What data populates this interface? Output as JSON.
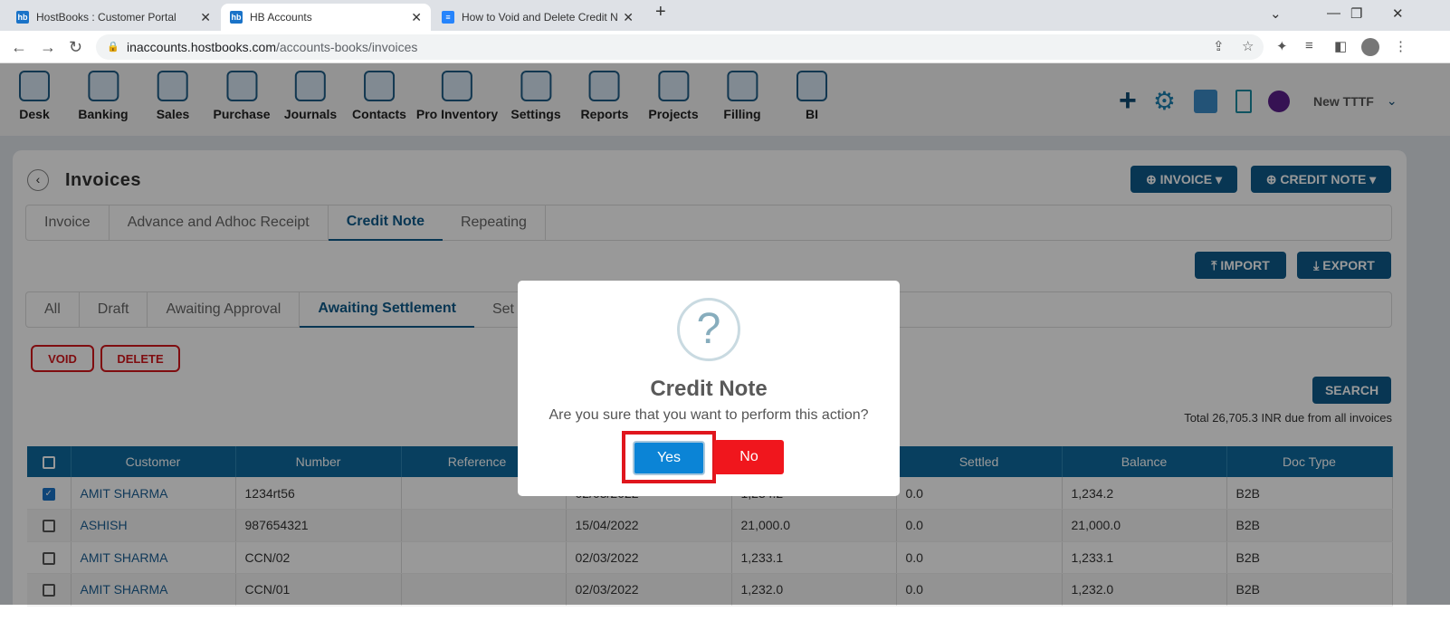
{
  "browser": {
    "tabs": [
      {
        "label": "HostBooks : Customer Portal",
        "icon": "hb"
      },
      {
        "label": "HB Accounts",
        "icon": "hb"
      },
      {
        "label": "How to Void and Delete Credit N",
        "icon": "doc"
      }
    ],
    "url_host": "inaccounts.hostbooks.com",
    "url_path": "/accounts-books/invoices"
  },
  "nav": {
    "items": [
      "Desk",
      "Banking",
      "Sales",
      "Purchase",
      "Journals",
      "Contacts",
      "Pro Inventory",
      "Settings",
      "Reports",
      "Projects",
      "Filling",
      "BI"
    ],
    "org": "New TTTF"
  },
  "page": {
    "title": "Invoices",
    "invoice_btn": "INVOICE",
    "credit_note_btn": "CREDIT NOTE",
    "tabs": [
      "Invoice",
      "Advance and Adhoc Receipt",
      "Credit Note",
      "Repeating"
    ],
    "import": "IMPORT",
    "export": "EXPORT",
    "subtabs": [
      "All",
      "Draft",
      "Awaiting Approval",
      "Awaiting Settlement",
      "Set"
    ],
    "void": "VOID",
    "delete": "DELETE",
    "search": "SEARCH",
    "total": "Total 26,705.3 INR due from all invoices"
  },
  "table": {
    "headers": [
      "Customer",
      "Number",
      "Reference",
      "",
      "",
      "Settled",
      "Balance",
      "Doc Type"
    ],
    "rows": [
      {
        "checked": true,
        "c": [
          "AMIT SHARMA",
          "1234rt56",
          "",
          "02/03/2022",
          "1,234.2",
          "0.0",
          "1,234.2",
          "B2B"
        ]
      },
      {
        "checked": false,
        "c": [
          "ASHISH",
          "987654321",
          "",
          "15/04/2022",
          "21,000.0",
          "0.0",
          "21,000.0",
          "B2B"
        ]
      },
      {
        "checked": false,
        "c": [
          "AMIT SHARMA",
          "CCN/02",
          "",
          "02/03/2022",
          "1,233.1",
          "0.0",
          "1,233.1",
          "B2B"
        ]
      },
      {
        "checked": false,
        "c": [
          "AMIT SHARMA",
          "CCN/01",
          "",
          "02/03/2022",
          "1,232.0",
          "0.0",
          "1,232.0",
          "B2B"
        ]
      }
    ]
  },
  "modal": {
    "title": "Credit Note",
    "text": "Are you sure that you want to perform this action?",
    "yes": "Yes",
    "no": "No"
  },
  "colors": {
    "primary": "#0e5a8a",
    "danger": "#f0161d",
    "yes": "#0b84d6"
  }
}
